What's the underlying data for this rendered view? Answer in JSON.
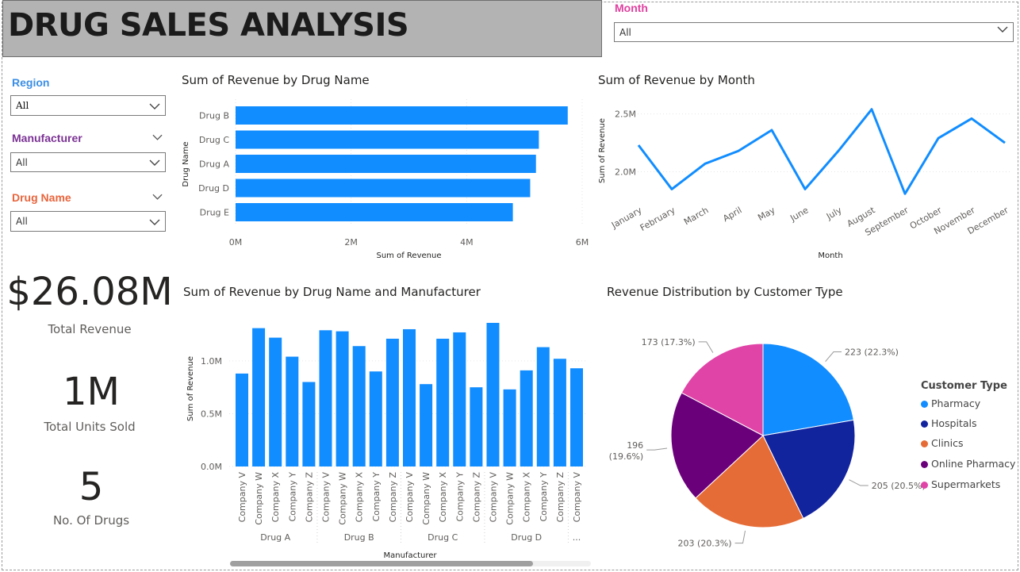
{
  "dashboard": {
    "title": "DRUG SALES ANALYSIS"
  },
  "slicers": {
    "month": {
      "label": "Month",
      "value": "All",
      "color": "#e040a0"
    },
    "region": {
      "label": "Region",
      "value": "All",
      "color": "#3a8ee6"
    },
    "manufacturer": {
      "label": "Manufacturer",
      "value": "All",
      "color": "#7b3294"
    },
    "drug_name": {
      "label": "Drug Name",
      "value": "All",
      "color": "#e8643c"
    }
  },
  "kpis": [
    {
      "value": "$26.08M",
      "label": "Total Revenue"
    },
    {
      "value": "1M",
      "label": "Total Units Sold"
    },
    {
      "value": "5",
      "label": "No. Of Drugs"
    }
  ],
  "visuals": {
    "bar_title": "Sum of Revenue by Drug Name",
    "line_title": "Sum of Revenue by Month",
    "column_title": "Sum of Revenue by Drug Name and Manufacturer",
    "pie_title": "Revenue Distribution by Customer Type"
  },
  "colors": {
    "bar": "#118dff",
    "line": "#118dff"
  },
  "chart_data": [
    {
      "type": "bar",
      "title": "Sum of Revenue by Drug Name",
      "categories": [
        "Drug B",
        "Drug C",
        "Drug A",
        "Drug D",
        "Drug E"
      ],
      "values": [
        5.75,
        5.25,
        5.2,
        5.1,
        4.8
      ],
      "xlabel": "Sum of Revenue",
      "ylabel": "Drug Name",
      "xlim": [
        0,
        6
      ],
      "xticks": [
        "0M",
        "2M",
        "4M",
        "6M"
      ]
    },
    {
      "type": "line",
      "title": "Sum of Revenue by Month",
      "categories": [
        "January",
        "February",
        "March",
        "April",
        "May",
        "June",
        "July",
        "August",
        "September",
        "October",
        "November",
        "December"
      ],
      "values": [
        2.23,
        1.85,
        2.07,
        2.18,
        2.36,
        1.85,
        2.18,
        2.54,
        1.81,
        2.29,
        2.46,
        2.25
      ],
      "xlabel": "Month",
      "ylabel": "Sum of Revenue",
      "ylim": [
        1.75,
        2.6
      ],
      "yticks": [
        {
          "v": 2.0,
          "label": "2.0M"
        },
        {
          "v": 2.5,
          "label": "2.5M"
        }
      ]
    },
    {
      "type": "bar",
      "title": "Sum of Revenue by Drug Name and Manufacturer",
      "groups": [
        {
          "name": "Drug A",
          "manufacturers": [
            "Company V",
            "Company W",
            "Company X",
            "Company Y",
            "Company Z"
          ],
          "values": [
            0.88,
            1.31,
            1.22,
            1.04,
            0.8
          ]
        },
        {
          "name": "Drug B",
          "manufacturers": [
            "Company V",
            "Company W",
            "Company X",
            "Company Y",
            "Company Z"
          ],
          "values": [
            1.29,
            1.28,
            1.14,
            0.9,
            1.21
          ]
        },
        {
          "name": "Drug C",
          "manufacturers": [
            "Company V",
            "Company W",
            "Company X",
            "Company Y",
            "Company Z"
          ],
          "values": [
            1.3,
            0.78,
            1.21,
            1.27,
            0.75
          ]
        },
        {
          "name": "Drug D",
          "manufacturers": [
            "Company V",
            "Company W",
            "Company X",
            "Company Y",
            "Company Z"
          ],
          "values": [
            1.36,
            0.73,
            0.91,
            1.13,
            1.02
          ]
        },
        {
          "name": "...",
          "manufacturers": [
            "Company V"
          ],
          "values": [
            0.93
          ]
        }
      ],
      "xlabel": "Manufacturer",
      "ylabel": "Sum of Revenue",
      "ylim": [
        0,
        1.45
      ],
      "yticks": [
        {
          "v": 0,
          "label": "0.0M"
        },
        {
          "v": 0.5,
          "label": "0.5M"
        },
        {
          "v": 1.0,
          "label": "1.0M"
        }
      ]
    },
    {
      "type": "pie",
      "title": "Revenue Distribution by Customer Type",
      "legend_title": "Customer Type",
      "legend_position": "right",
      "slices": [
        {
          "name": "Pharmacy",
          "value": 223,
          "label": "223 (22.3%)",
          "color": "#118dff"
        },
        {
          "name": "Hospitals",
          "value": 205,
          "label": "205 (20.5%)",
          "color": "#12239e"
        },
        {
          "name": "Clinics",
          "value": 203,
          "label": "203 (20.3%)",
          "color": "#e66c37"
        },
        {
          "name": "Online Pharmacy",
          "value": 196,
          "label": "196 (19.6%)",
          "color": "#6b007b"
        },
        {
          "name": "Supermarkets",
          "value": 173,
          "label": "173 (17.3%)",
          "color": "#e044a7"
        }
      ]
    }
  ]
}
